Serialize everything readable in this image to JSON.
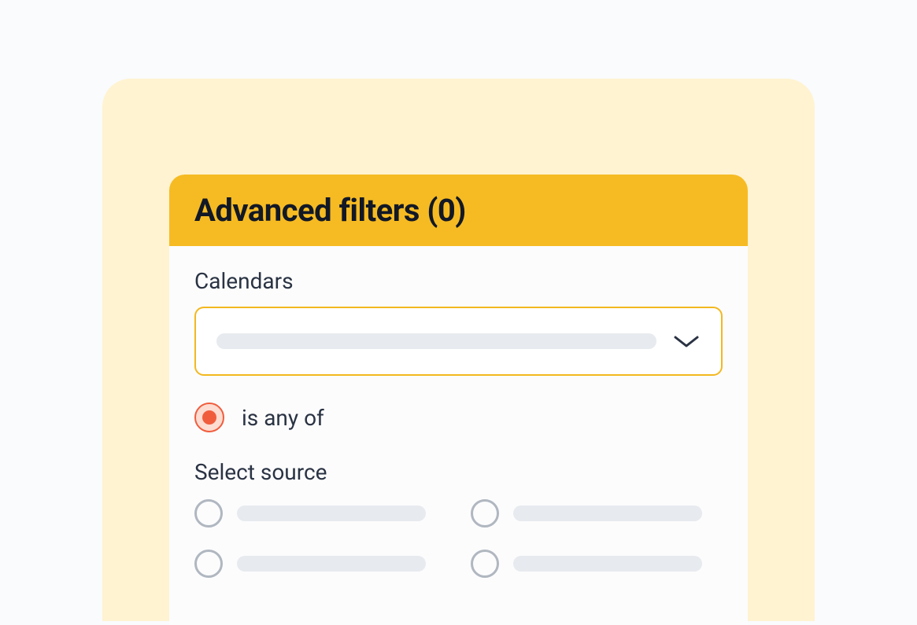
{
  "panel": {
    "title": "Advanced filters (0)",
    "calendars": {
      "label": "Calendars"
    },
    "filter_mode": {
      "label": "is any of",
      "selected": true
    },
    "source": {
      "label": "Select source",
      "options": [
        {
          "selected": false
        },
        {
          "selected": false
        },
        {
          "selected": false
        },
        {
          "selected": false
        }
      ]
    }
  },
  "colors": {
    "accent": "#F6BB23",
    "card_bg": "#FFF3D1",
    "radio_active": "#F05D3D",
    "skeleton": "#E7EAEE",
    "border_muted": "#B0B7C0"
  }
}
